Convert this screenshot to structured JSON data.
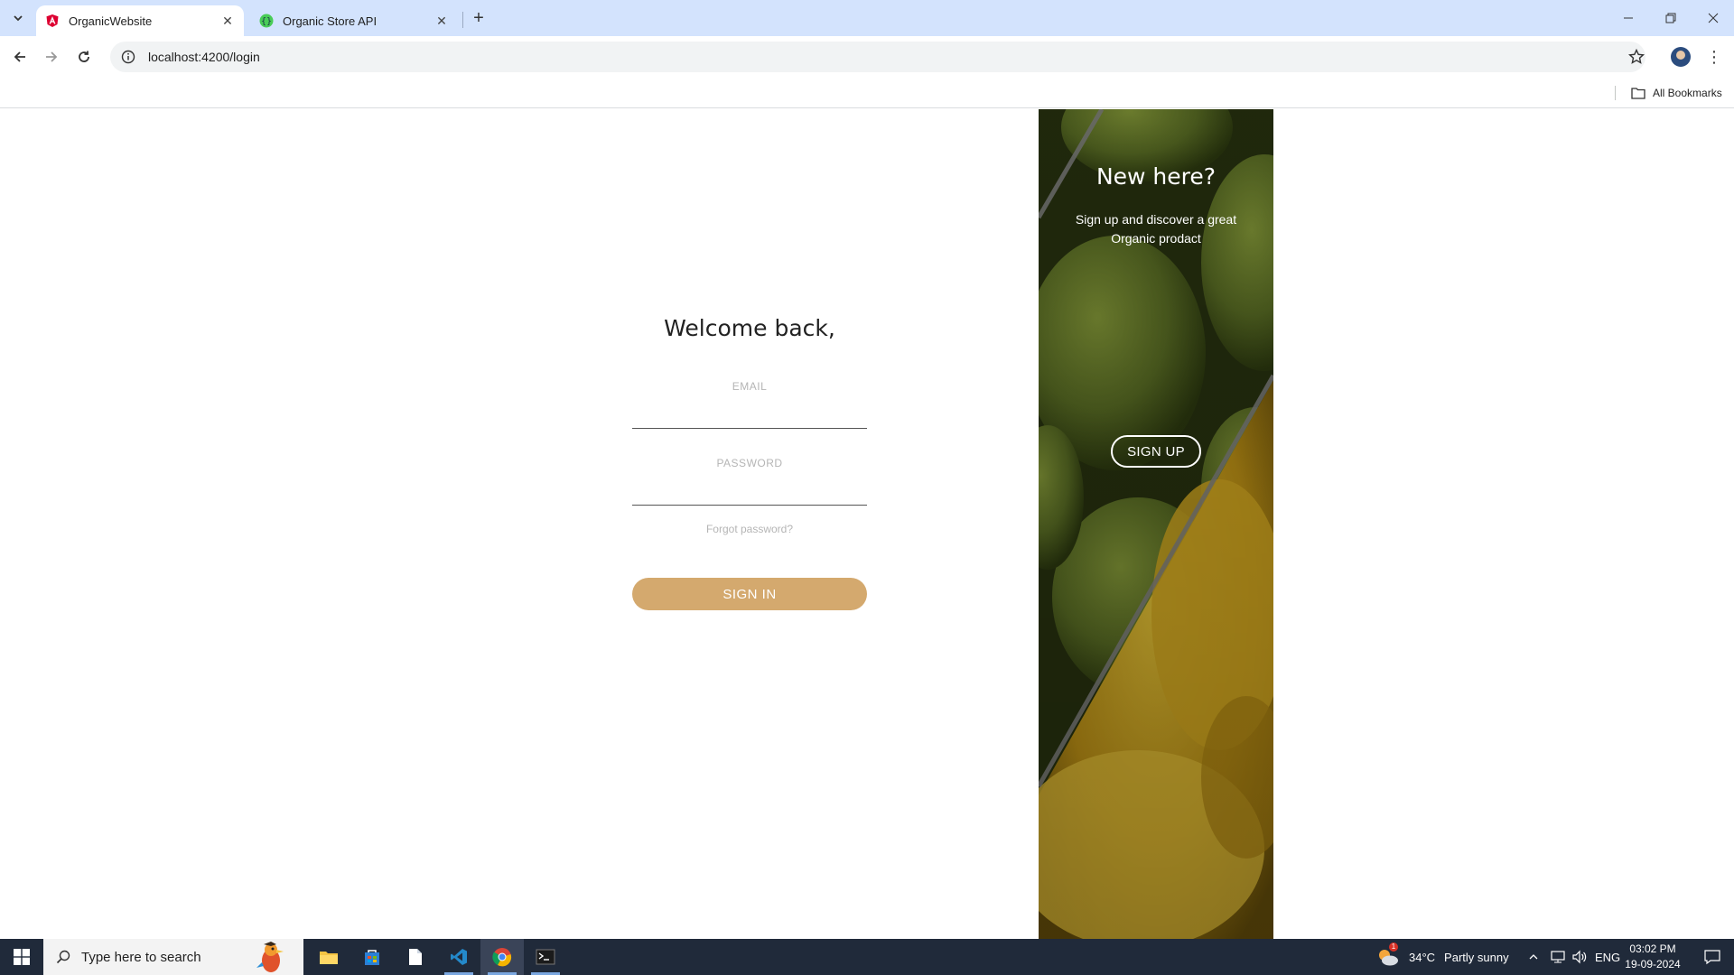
{
  "browser": {
    "tabs": [
      {
        "title": "OrganicWebsite",
        "active": true,
        "icon": "angular-icon"
      },
      {
        "title": "Organic Store API",
        "active": false,
        "icon": "swagger-icon"
      }
    ],
    "url": "localhost:4200/login",
    "bookmarks_label": "All Bookmarks"
  },
  "login": {
    "heading": "Welcome back,",
    "email_label": "EMAIL",
    "email_value": "",
    "password_label": "PASSWORD",
    "password_value": "",
    "forgot_link": "Forgot password?",
    "signin_label": "SIGN IN"
  },
  "promo": {
    "title": "New here?",
    "subtitle": "Sign up and discover a great Organic prodact",
    "signup_label": "SIGN UP"
  },
  "taskbar": {
    "search_placeholder": "Type here to search",
    "weather_temp": "34°C",
    "weather_text": "Partly sunny",
    "weather_badge": "1",
    "language": "ENG",
    "time": "03:02 PM",
    "date": "19-09-2024"
  },
  "colors": {
    "accent": "#d4a96e",
    "tabstrip": "#d3e3fd",
    "taskbar": "#202a3a"
  }
}
